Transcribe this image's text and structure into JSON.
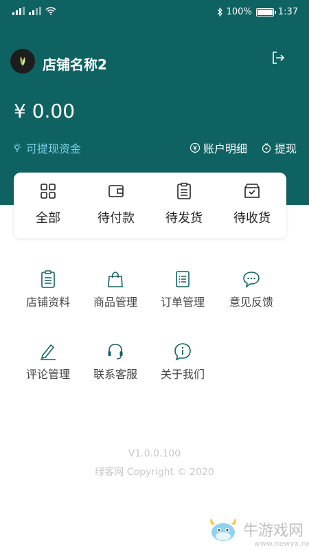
{
  "status_bar": {
    "battery": "100%",
    "time": "1:37"
  },
  "header": {
    "store_name": "店铺名称2",
    "balance": "¥ 0.00",
    "withdrawable_label": "可提现资金",
    "account_detail_label": "账户明细",
    "withdraw_label": "提现",
    "colors": {
      "header_bg": "#0f6262",
      "accent_text": "#7fd0e6"
    }
  },
  "orders": {
    "items": [
      {
        "label": "全部",
        "icon": "grid-icon"
      },
      {
        "label": "待付款",
        "icon": "wallet-icon"
      },
      {
        "label": "待发货",
        "icon": "clipboard-icon"
      },
      {
        "label": "待收货",
        "icon": "box-check-icon"
      }
    ]
  },
  "menu": {
    "items": [
      {
        "label": "店铺资料",
        "icon": "clipboard-icon"
      },
      {
        "label": "商品管理",
        "icon": "shopping-bag-icon"
      },
      {
        "label": "订单管理",
        "icon": "list-icon"
      },
      {
        "label": "意见反馈",
        "icon": "chat-icon"
      },
      {
        "label": "评论管理",
        "icon": "pen-icon"
      },
      {
        "label": "联系客服",
        "icon": "headset-icon"
      },
      {
        "label": "关于我们",
        "icon": "info-icon"
      }
    ],
    "icon_color": "#0f6262"
  },
  "footer": {
    "version": "V1.0.0.100",
    "copyright": "绿客网 Copyright © 2020"
  },
  "watermark": {
    "brand": "牛游戏网",
    "url": "www.newyx.net"
  }
}
